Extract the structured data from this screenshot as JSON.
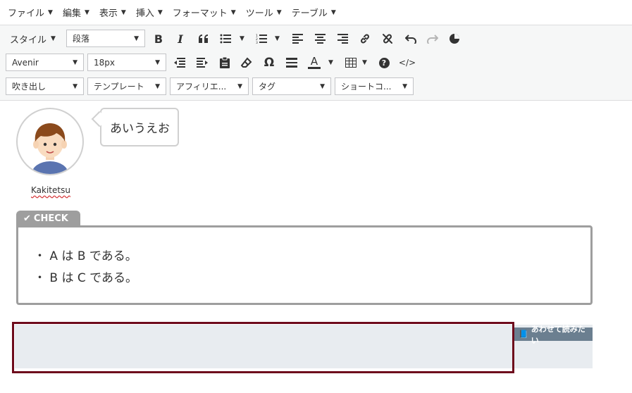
{
  "menubar": {
    "items": [
      {
        "label": "ファイル"
      },
      {
        "label": "編集"
      },
      {
        "label": "表示"
      },
      {
        "label": "挿入"
      },
      {
        "label": "フォーマット"
      },
      {
        "label": "ツール"
      },
      {
        "label": "テーブル"
      }
    ]
  },
  "toolbar": {
    "row1": {
      "style_label": "スタイル",
      "format_select": "段落",
      "buttons": [
        "bold-icon",
        "italic-icon",
        "blockquote-icon",
        "bullet-list-icon",
        "numbered-list-icon",
        "align-left-icon",
        "align-center-icon",
        "align-right-icon",
        "link-icon",
        "unlink-icon",
        "undo-icon",
        "redo-icon",
        "pie-chart-icon"
      ]
    },
    "row2": {
      "font_select": "Avenir",
      "size_select": "18px",
      "buttons": [
        "outdent-icon",
        "indent-icon",
        "paste-icon",
        "eraser-icon",
        "omega-icon",
        "horizontal-rule-icon",
        "text-color-icon",
        "table-icon",
        "help-icon",
        "code-icon"
      ],
      "omega_glyph": "Ω",
      "text_color_glyph": "A",
      "help_glyph": "?",
      "code_glyph": "</>"
    },
    "row3": {
      "selects": [
        "吹き出し",
        "テンプレート",
        "アフィリエ...",
        "タグ",
        "ショートコ..."
      ]
    }
  },
  "content": {
    "speech": {
      "avatar_name": "Kakitetsu",
      "bubble_text": "あいうえお"
    },
    "check_box": {
      "tab_label": "CHECK",
      "lines": [
        "・ A は B である。",
        "・ B は C である。"
      ]
    },
    "related": {
      "tab_label": "あわせて読みたい"
    }
  },
  "colors": {
    "check_border": "#9e9e9e",
    "related_tab": "#6b7f90",
    "related_bg": "#e8ecf0",
    "highlight_border": "#6e0b1c"
  }
}
